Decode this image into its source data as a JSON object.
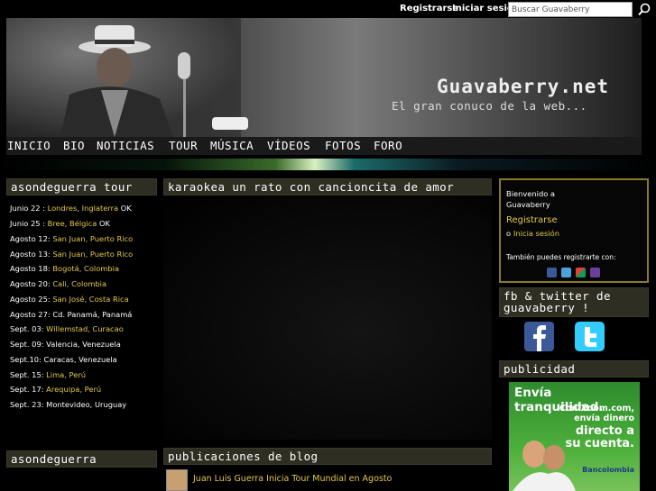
{
  "topbar": {
    "register": "Registrarse",
    "login": "Iniciar sesión",
    "search_placeholder": "Buscar Guavaberry"
  },
  "header": {
    "title": "Guavaberry.net",
    "tagline": "El gran conuco de la web..."
  },
  "nav": [
    "INICIO",
    "BIO",
    "NOTICIAS",
    "TOUR",
    "MÚSICA",
    "VÍDEOS",
    "FOTOS",
    "FORO"
  ],
  "tour": {
    "title": "asondeguerra tour",
    "dates": [
      {
        "date": "Junio 22 :",
        "place": "Londres, Inglaterra",
        "note": "OK"
      },
      {
        "date": "Junio 25 :",
        "place": "Bree, Bélgica",
        "note": "OK"
      },
      {
        "date": "Agosto 12:",
        "place": "San Juan, Puerto Rico",
        "note": ""
      },
      {
        "date": "Agosto 13:",
        "place": "San Juan, Puerto Rico",
        "note": ""
      },
      {
        "date": "Agosto 18:",
        "place": "Bogotá, Colombia",
        "note": ""
      },
      {
        "date": "Agosto 20:",
        "place": "Cali, Colombia",
        "note": ""
      },
      {
        "date": "Agosto 25:",
        "place": "San José, Costa Rica",
        "note": ""
      },
      {
        "date": "Agosto 27:",
        "place": "Cd. Panamá, Panamá",
        "note": ""
      },
      {
        "date": "Sept. 03:",
        "place": "Willemstad, Curacao",
        "note": ""
      },
      {
        "date": "Sept. 09:",
        "place": "Valencia, Venezuela",
        "note": ""
      },
      {
        "date": "Sept.10:",
        "place": "Caracas, Venezuela",
        "note": ""
      },
      {
        "date": "Sept. 15:",
        "place": "Lima, Perú",
        "note": ""
      },
      {
        "date": "Sept. 17:",
        "place": "Arequipa, Perú",
        "note": ""
      },
      {
        "date": "Sept. 23:",
        "place": "Montevideo, Uruguay",
        "note": ""
      }
    ]
  },
  "left_box2": {
    "title": "asondeguerra"
  },
  "video": {
    "title": "karaokea un rato con cancioncita de amor"
  },
  "blog": {
    "title": "publicaciones de blog",
    "first_post": "Juan Luis Guerra Inicia Tour Mundial en Agosto"
  },
  "signin": {
    "welcome": "Bienvenido a",
    "site": "Guavaberry",
    "register": "Registrarse",
    "or": "o",
    "login": "Inicia sesión",
    "also": "También puedes registrarte con:"
  },
  "social_box": {
    "title_line1": "fb & twitter de",
    "title_line2": "guavaberry !"
  },
  "publicidad": {
    "title": "publicidad"
  },
  "ad": {
    "headline": "Envía tranquilidad.",
    "line1": "Con Xoom.com,",
    "line2": "envía dinero",
    "line3": "directo a",
    "line4": "su cuenta.",
    "brand": "Bancolombia"
  },
  "colors": {
    "accent": "#e5c94a",
    "box_title_bg": "#2e2e22",
    "signin_border": "#8a7a2a"
  }
}
